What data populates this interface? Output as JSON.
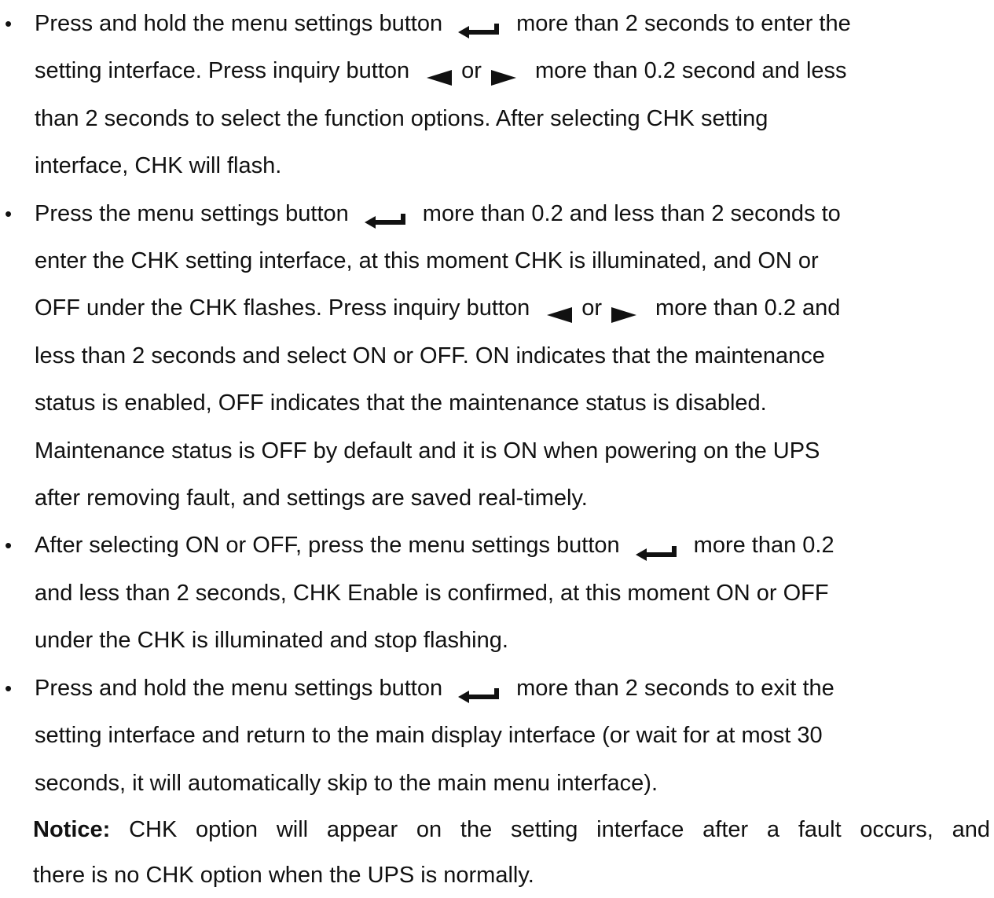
{
  "bullets": [
    {
      "lines": [
        [
          "Press and hold the menu settings button",
          "{enter}",
          "more than 2 seconds to enter the"
        ],
        [
          "setting interface. Press inquiry button",
          "{left}",
          "or",
          "{right}",
          "more than 0.2 second and less"
        ],
        [
          "than 2 seconds to select the function options. After selecting CHK setting"
        ],
        [
          "interface, CHK will flash."
        ]
      ]
    },
    {
      "lines": [
        [
          "Press the menu settings button",
          "{enter}",
          "more than 0.2 and less than 2 seconds to"
        ],
        [
          "enter the CHK setting interface, at this moment CHK is illuminated, and ON or"
        ],
        [
          "OFF under the CHK flashes. Press inquiry button",
          "{left}",
          "or",
          "{right}",
          "more than 0.2 and"
        ],
        [
          "less than 2 seconds and select ON or OFF. ON indicates that the maintenance"
        ],
        [
          "status is enabled, OFF indicates that the maintenance status is disabled."
        ],
        [
          "Maintenance status is OFF by default and it is ON when powering on the UPS"
        ],
        [
          "after removing fault, and settings are saved real-timely."
        ]
      ]
    },
    {
      "lines": [
        [
          "After selecting ON or OFF, press the menu settings button",
          "{enter}",
          "more than 0.2"
        ],
        [
          "and less than 2 seconds, CHK Enable is confirmed, at this moment ON or OFF"
        ],
        [
          "under the CHK is illuminated and stop flashing."
        ]
      ]
    },
    {
      "lines": [
        [
          "Press and hold the menu settings button",
          "{enter}",
          "more than 2 seconds to exit the"
        ],
        [
          "setting interface and return to the main display interface (or wait for at most 30"
        ],
        [
          "seconds, it will automatically skip to the main menu interface)."
        ]
      ]
    }
  ],
  "notice": {
    "label": "Notice:",
    "line1": "CHK option will appear on the setting interface after a fault occurs, and",
    "line2": "there is no CHK option when the UPS is normally."
  },
  "icons": {
    "enter": "enter-key-icon",
    "left": "left-arrow-icon",
    "right": "right-arrow-icon"
  }
}
